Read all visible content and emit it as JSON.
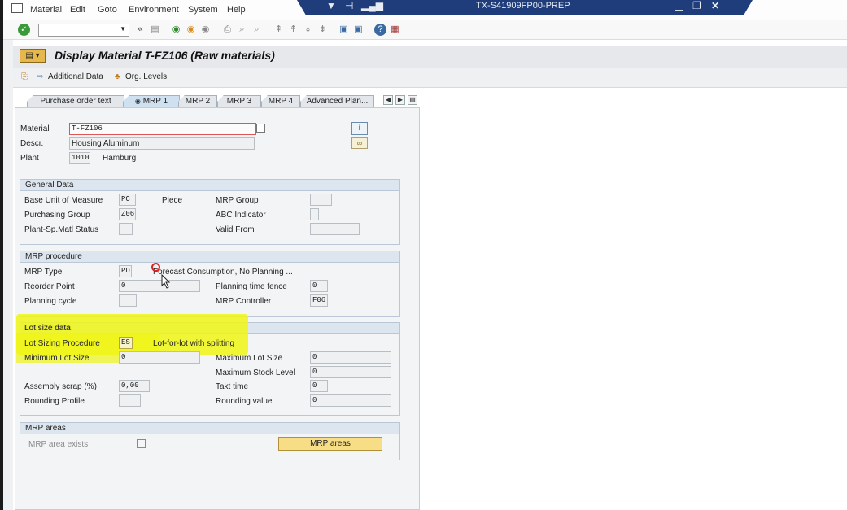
{
  "menu": {
    "items": [
      "Material",
      "Edit",
      "Goto",
      "Environment",
      "System",
      "Help"
    ]
  },
  "system": {
    "title": "TX-S41909FP00-PREP"
  },
  "toolbar": {
    "command_field_value": ""
  },
  "page": {
    "title": "Display Material T-FZ106 (Raw materials)"
  },
  "app_toolbar": {
    "additional_data": "Additional Data",
    "org_levels": "Org. Levels"
  },
  "tabs": [
    {
      "label": "Purchase order text",
      "active": false
    },
    {
      "label": "MRP 1",
      "active": true
    },
    {
      "label": "MRP 2",
      "active": false
    },
    {
      "label": "MRP 3",
      "active": false
    },
    {
      "label": "MRP 4",
      "active": false
    },
    {
      "label": "Advanced Plan...",
      "active": false
    }
  ],
  "header": {
    "material_label": "Material",
    "material_value": "T-FZ106",
    "descr_label": "Descr.",
    "descr_value": "Housing Aluminum",
    "plant_label": "Plant",
    "plant_value": "1010",
    "plant_name": "Hamburg"
  },
  "general_data": {
    "title": "General Data",
    "base_uom_label": "Base Unit of Measure",
    "base_uom_value": "PC",
    "base_uom_text": "Piece",
    "purchasing_group_label": "Purchasing Group",
    "purchasing_group_value": "Z06",
    "plant_sp_status_label": "Plant-Sp.Matl Status",
    "plant_sp_status_value": "",
    "mrp_group_label": "MRP Group",
    "mrp_group_value": "",
    "abc_indicator_label": "ABC Indicator",
    "abc_indicator_value": "",
    "valid_from_label": "Valid From",
    "valid_from_value": ""
  },
  "mrp_procedure": {
    "title": "MRP procedure",
    "mrp_type_label": "MRP Type",
    "mrp_type_value": "PD",
    "mrp_type_text": "Forecast Consumption, No Planning ...",
    "reorder_point_label": "Reorder Point",
    "reorder_point_value": "0",
    "planning_cycle_label": "Planning cycle",
    "planning_cycle_value": "",
    "planning_fence_label": "Planning time fence",
    "planning_fence_value": "0",
    "mrp_controller_label": "MRP Controller",
    "mrp_controller_value": "F06"
  },
  "lot_size": {
    "title": "Lot size data",
    "procedure_label": "Lot Sizing Procedure",
    "procedure_value": "ES",
    "procedure_text": "Lot-for-lot with splitting",
    "min_lot_label": "Minimum Lot Size",
    "min_lot_value": "0",
    "max_lot_label": "Maximum Lot Size",
    "max_lot_value": "0",
    "max_stock_label": "Maximum Stock Level",
    "max_stock_value": "0",
    "assembly_scrap_label": "Assembly scrap (%)",
    "assembly_scrap_value": "0,00",
    "takt_time_label": "Takt time",
    "takt_time_value": "0",
    "rounding_profile_label": "Rounding Profile",
    "rounding_profile_value": "",
    "rounding_value_label": "Rounding value",
    "rounding_value_value": "0"
  },
  "mrp_areas": {
    "title": "MRP areas",
    "exists_label": "MRP area exists",
    "button_label": "MRP areas"
  },
  "colors": {
    "title_bar": "#1f3d7a",
    "highlight": "#f0f514",
    "button": "#f7dd86"
  }
}
